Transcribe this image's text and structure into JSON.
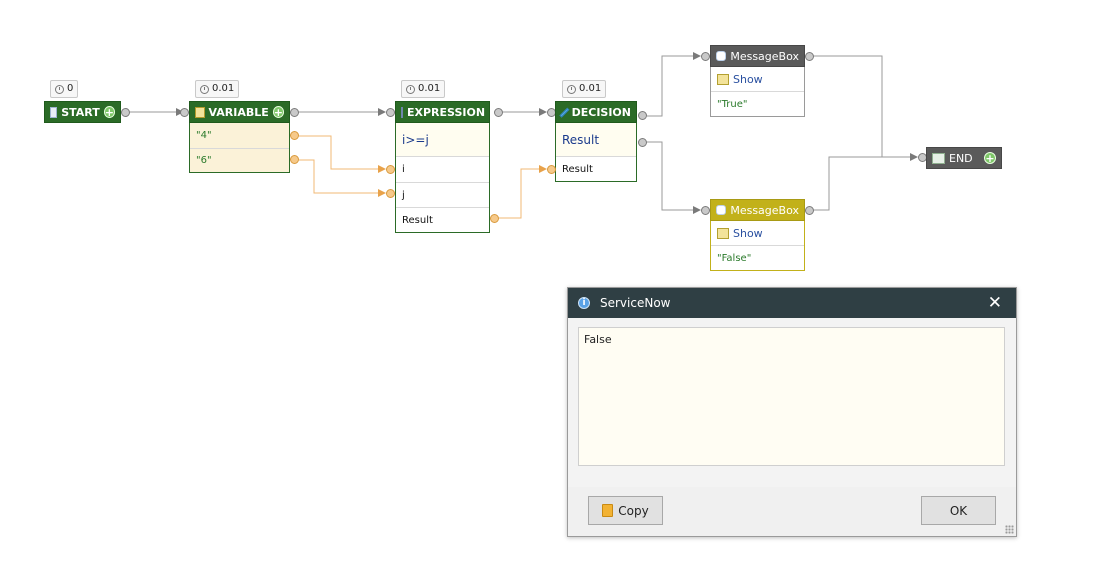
{
  "flow": {
    "start": {
      "label": "START",
      "timer": "0"
    },
    "variable": {
      "label": "VARIABLE",
      "timer": "0.01",
      "values": [
        "\"4\"",
        "\"6\""
      ]
    },
    "expression": {
      "label": "EXPRESSION",
      "timer": "0.01",
      "formula": "i>=j",
      "inputs": [
        "i",
        "j"
      ],
      "output": "Result"
    },
    "decision": {
      "label": "DECISION",
      "timer": "0.01",
      "condition": "Result",
      "input": "Result"
    },
    "msgbox_true": {
      "label": "MessageBox",
      "method": "Show",
      "value": "\"True\""
    },
    "msgbox_false": {
      "label": "MessageBox",
      "method": "Show",
      "value": "\"False\""
    },
    "end": {
      "label": "END"
    }
  },
  "dialog": {
    "title": "ServiceNow",
    "message": "False",
    "copy_label": "Copy",
    "ok_label": "OK"
  },
  "colors": {
    "node_green": "#2b6b27",
    "node_gray": "#5a5a5a",
    "node_yellow": "#c2b11a",
    "dialog_title": "#2f3f44"
  }
}
